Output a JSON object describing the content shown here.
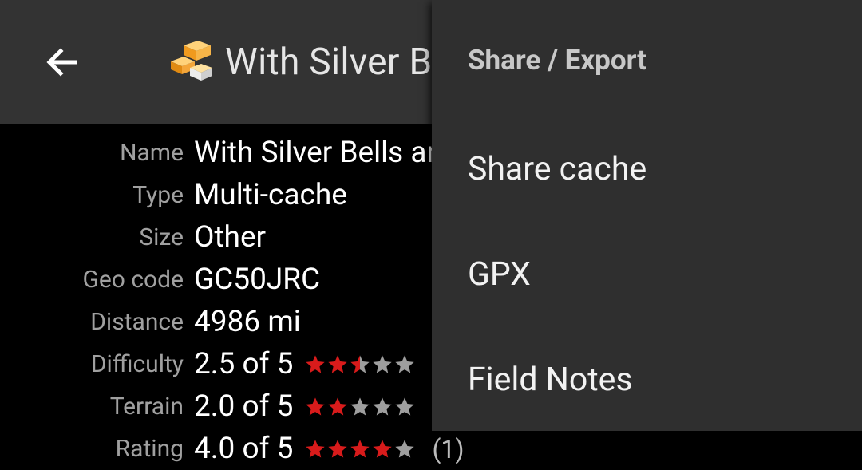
{
  "appbar": {
    "title": "With Silver Bells and Cockle Shells",
    "back_icon": "arrow-left-icon",
    "cache_icon": "multi-cache-icon"
  },
  "details": [
    {
      "label": "Name",
      "value": "With Silver Bells and Cockle Shells"
    },
    {
      "label": "Type",
      "value": "Multi-cache"
    },
    {
      "label": "Size",
      "value": "Other"
    },
    {
      "label": "Geo code",
      "value": "GC50JRC"
    },
    {
      "label": "Distance",
      "value": "4986 mi"
    },
    {
      "label": "Difficulty",
      "value": "2.5 of 5",
      "rating": 2.5
    },
    {
      "label": "Terrain",
      "value": "2.0 of 5",
      "rating": 2.0
    },
    {
      "label": "Rating",
      "value": "4.0 of 5",
      "rating": 4.0,
      "extra": "(1)"
    }
  ],
  "menu": {
    "header": "Share / Export",
    "items": [
      "Share cache",
      "GPX",
      "Field Notes"
    ]
  },
  "colors": {
    "appbar": "#333333",
    "menu_bg": "#2f2f2f",
    "star_fill": "#d81b1b",
    "star_empty": "#9e9e9e"
  }
}
